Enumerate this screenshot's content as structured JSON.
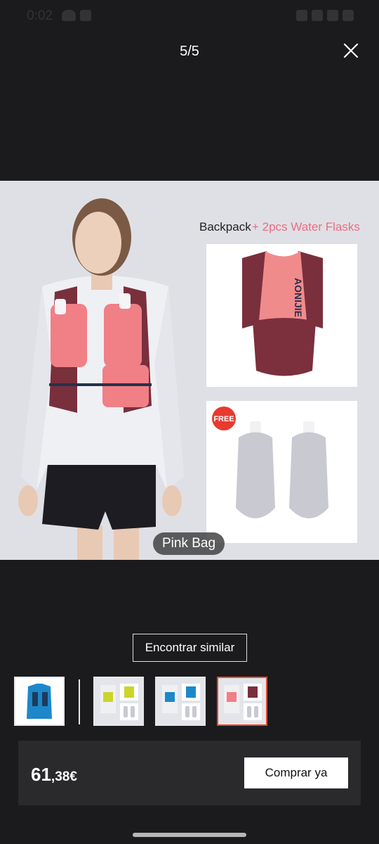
{
  "status_bar": {
    "time": "0:02"
  },
  "viewer": {
    "page_counter": "5/5",
    "image_label": "Pink Bag",
    "image_texts": {
      "heading_black": "Backpack",
      "heading_pink": "+ 2pcs Water Flasks",
      "free_badge": "FREE",
      "brand": "AONIJIE"
    }
  },
  "actions": {
    "find_similar_label": "Encontrar similar"
  },
  "thumbnails": [
    {
      "name": "blue-vest",
      "active": false
    },
    {
      "name": "yellow-variant",
      "active": false
    },
    {
      "name": "blue-variant",
      "active": false
    },
    {
      "name": "pink-variant",
      "active": true
    }
  ],
  "purchase": {
    "price_integer": "61",
    "price_decimal": ",38€",
    "buy_label": "Comprar ya"
  },
  "colors": {
    "background": "#1b1b1d",
    "buy_bar": "#2a2a2d",
    "active_thumb_border": "#e24a2f",
    "flask_heading_pink": "#ef6b84"
  }
}
